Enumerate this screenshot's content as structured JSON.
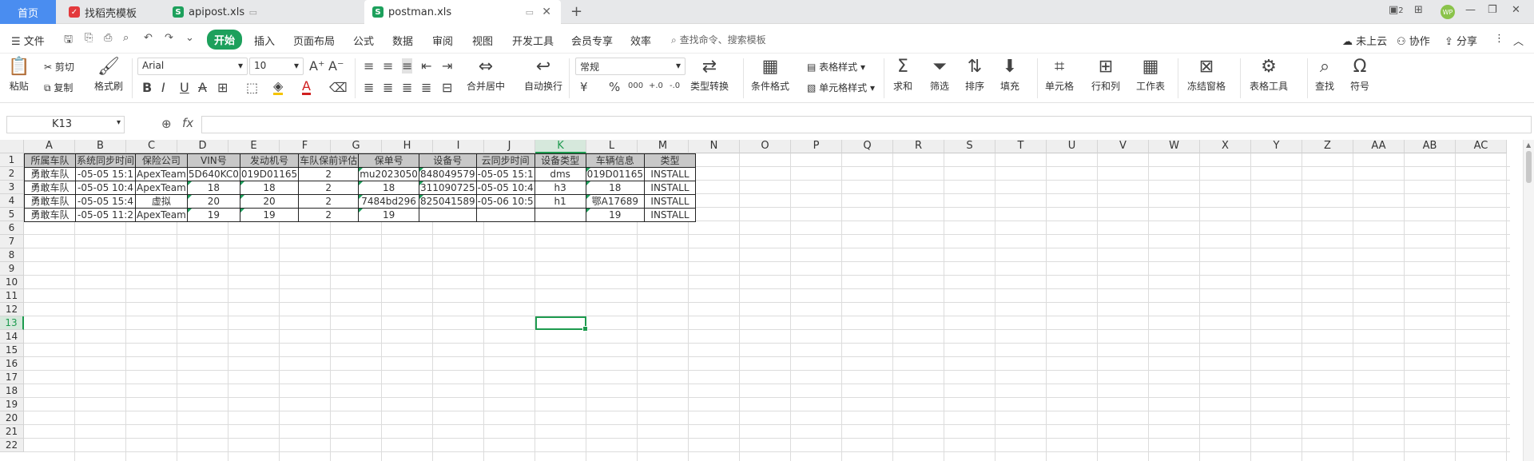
{
  "tabs": {
    "home": "首页",
    "t1": "找稻壳模板",
    "t2": "apipost.xls",
    "t3": "postman.xls"
  },
  "window": {
    "restore_label": "2",
    "avatar": "WP"
  },
  "menu": {
    "file": "文件",
    "start": "开始",
    "insert": "插入",
    "layout": "页面布局",
    "formula": "公式",
    "data": "数据",
    "review": "审阅",
    "view": "视图",
    "dev": "开发工具",
    "vip": "会员专享",
    "efficiency": "效率",
    "search_placeholder": "查找命令、搜索模板",
    "cloud": "未上云",
    "collab": "协作",
    "share": "分享"
  },
  "ribbon": {
    "paste": "粘贴",
    "cut": "剪切",
    "copy": "复制",
    "format_painter": "格式刷",
    "font_name": "Arial",
    "font_size": "10",
    "merge_center": "合并居中",
    "auto_wrap": "自动换行",
    "number_format": "常规",
    "type_convert": "类型转换",
    "cond_format": "条件格式",
    "table_style": "表格样式",
    "cell_style": "单元格样式",
    "sum": "求和",
    "filter": "筛选",
    "sort": "排序",
    "fill": "填充",
    "cell": "单元格",
    "row_col": "行和列",
    "worksheet": "工作表",
    "freeze": "冻结窗格",
    "table_tools": "表格工具",
    "find": "查找",
    "symbol": "符号",
    "bold": "B",
    "italic": "I",
    "underline": "U",
    "strike": "A",
    "font_color": "A",
    "currency": "¥",
    "percent": "%",
    "thousand": "000",
    "dec_inc": "+.0",
    "dec_dec": "-.0"
  },
  "formula_bar": {
    "name_box": "K13",
    "fx": "fx",
    "value": ""
  },
  "sheet": {
    "columns": [
      "A",
      "B",
      "C",
      "D",
      "E",
      "F",
      "G",
      "H",
      "I",
      "J",
      "K",
      "L",
      "M",
      "N",
      "O",
      "P",
      "Q",
      "R",
      "S",
      "T",
      "U",
      "V",
      "W",
      "X",
      "Y",
      "Z",
      "AA",
      "AB",
      "AC"
    ],
    "rows": [
      "1",
      "2",
      "3",
      "4",
      "5",
      "6",
      "7",
      "8",
      "9",
      "10",
      "11",
      "12",
      "13",
      "14",
      "15",
      "16",
      "17",
      "18",
      "19",
      "20",
      "21",
      "22"
    ],
    "selected_col": "K",
    "selected_row": "13",
    "header_row": [
      "所属车队",
      "系统同步时间",
      "保险公司",
      "VIN号",
      "发动机号",
      "车队保前评估",
      "保单号",
      "设备号",
      "云同步时间",
      "设备类型",
      "车辆信息",
      "类型"
    ],
    "data": [
      [
        "勇敢车队",
        "-05-05 15:1",
        "ApexTeam",
        "5D640KC0",
        "019D01165",
        "2",
        "mu2023050",
        "848049579",
        "-05-05 15:1",
        "dms",
        "019D01165",
        "INSTALL"
      ],
      [
        "勇敢车队",
        "-05-05 10:4",
        "ApexTeam",
        "18",
        "18",
        "2",
        "18",
        "311090725",
        "-05-05 10:4",
        "h3",
        "18",
        "INSTALL"
      ],
      [
        "勇敢车队",
        "-05-05 15:4",
        "虚拟",
        "20",
        "20",
        "2",
        "7484bd296",
        "825041589",
        "-05-06 10:5",
        "h1",
        "鄂A17689",
        "INSTALL"
      ],
      [
        "勇敢车队",
        "-05-05 11:2",
        "ApexTeam",
        "19",
        "19",
        "2",
        "19",
        "",
        "",
        "",
        "19",
        "INSTALL"
      ]
    ]
  },
  "colors": {
    "accent": "#1da05c",
    "tab_home": "#4a8df0",
    "selection": "#1e9b4f"
  }
}
